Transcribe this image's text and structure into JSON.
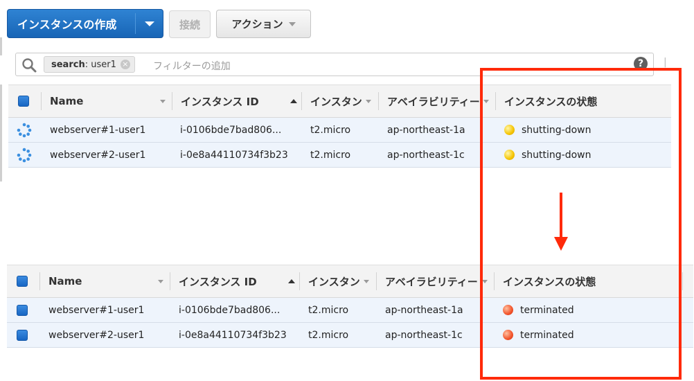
{
  "toolbar": {
    "create_label": "インスタンスの作成",
    "connect_label": "接続",
    "action_label": "アクション"
  },
  "search": {
    "token_key": "search",
    "token_value": ": user1",
    "placeholder": "フィルターの追加"
  },
  "columns": {
    "name": "Name",
    "instance_id": "インスタンス ID",
    "instance_type": "インスタン",
    "az": "アベイラビリティー",
    "state": "インスタンスの状態"
  },
  "before_rows": [
    {
      "name": "webserver#1-user1",
      "id": "i-0106bde7bad806...",
      "type": "t2.micro",
      "az": "ap-northeast-1a",
      "state": "shutting-down"
    },
    {
      "name": "webserver#2-user1",
      "id": "i-0e8a44110734f3b23",
      "type": "t2.micro",
      "az": "ap-northeast-1c",
      "state": "shutting-down"
    }
  ],
  "after_rows": [
    {
      "name": "webserver#1-user1",
      "id": "i-0106bde7bad806...",
      "type": "t2.micro",
      "az": "ap-northeast-1a",
      "state": "terminated"
    },
    {
      "name": "webserver#2-user1",
      "id": "i-0e8a44110734f3b23",
      "type": "t2.micro",
      "az": "ap-northeast-1c",
      "state": "terminated"
    }
  ],
  "colors": {
    "primary_button": "#1f6fc5",
    "shutting_down": "#f5c400",
    "terminated": "#f2532a",
    "annotation": "#ff2a0a"
  }
}
